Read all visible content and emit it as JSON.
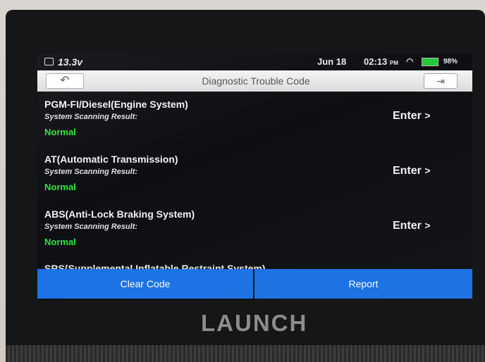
{
  "status_bar": {
    "voltage": "13.3v",
    "date": "Jun 18",
    "time": "02:13",
    "time_suffix": "PM",
    "battery_percent": "98%",
    "battery_color": "#24c83a"
  },
  "header": {
    "title": "Diagnostic Trouble Code",
    "back_icon": "back-arrow-icon",
    "exit_icon": "exit-icon"
  },
  "systems": [
    {
      "name": "PGM-FI/Diesel(Engine System)",
      "result_label": "System Scanning Result:",
      "status": "Normal",
      "action": "Enter",
      "action_chevron": ">"
    },
    {
      "name": "AT(Automatic Transmission)",
      "result_label": "System Scanning Result:",
      "status": "Normal",
      "action": "Enter",
      "action_chevron": ">"
    },
    {
      "name": "ABS(Anti-Lock Braking System)",
      "result_label": "System Scanning Result:",
      "status": "Normal",
      "action": "Enter",
      "action_chevron": ">"
    }
  ],
  "partial_system": {
    "name": "SRS(Supplemental Inflatable Restraint System)"
  },
  "footer": {
    "clear_label": "Clear Code",
    "report_label": "Report",
    "button_color": "#1a73e8"
  },
  "device": {
    "brand": "LAUNCH"
  }
}
